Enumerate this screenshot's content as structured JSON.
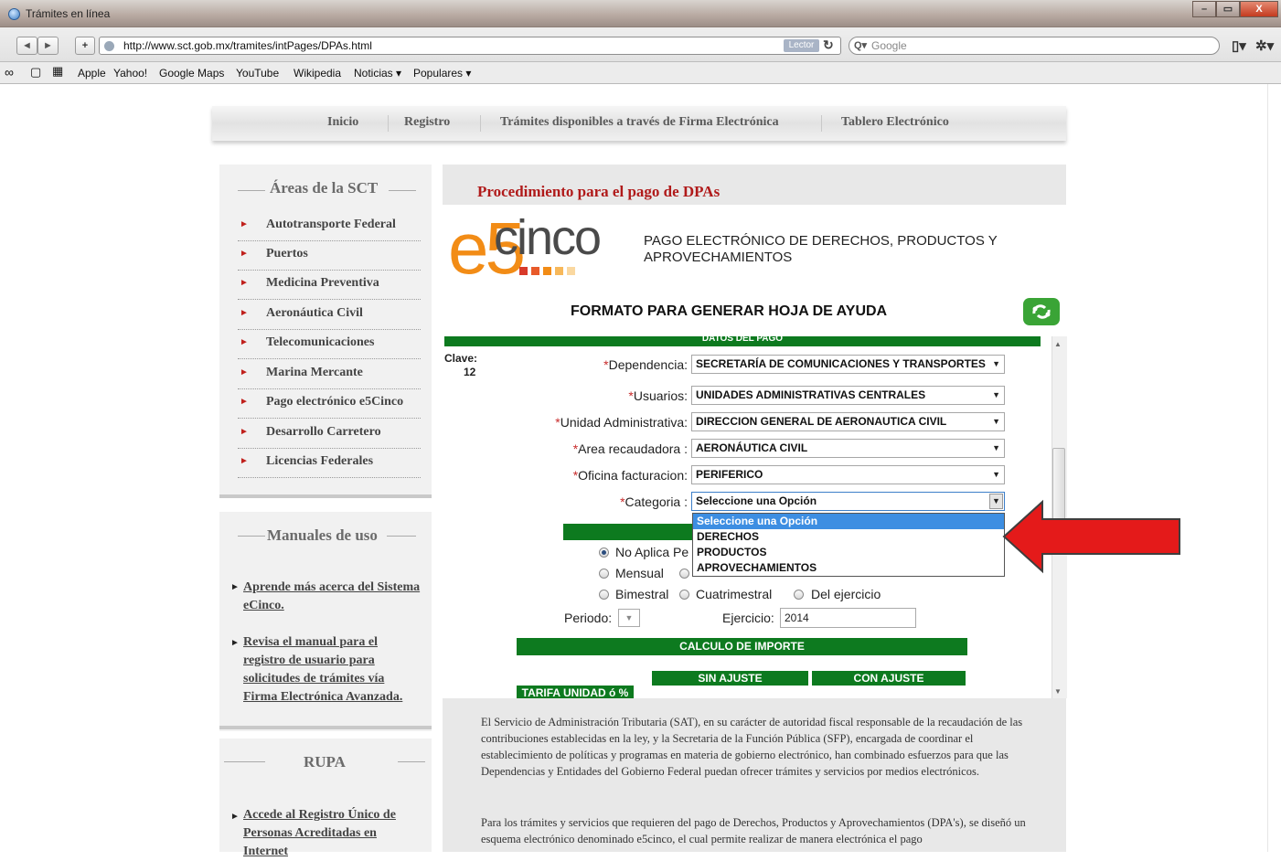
{
  "window": {
    "title": "Trámites en línea",
    "minimize": "–",
    "restore": "▭",
    "close": "X"
  },
  "toolbar": {
    "back": "◄",
    "forward": "►",
    "add": "+",
    "url": "http://www.sct.gob.mx/tramites/intPages/DPAs.html",
    "reader": "Lector",
    "reload": "↻",
    "search_placeholder": "Google",
    "search_glyph": "Q▾",
    "page_menu": "▯▾",
    "gear_menu": "✲▾"
  },
  "bookmarks": {
    "items": [
      "Apple",
      "Yahoo!",
      "Google Maps",
      "YouTube",
      "Wikipedia",
      "Noticias ▾",
      "Populares ▾"
    ]
  },
  "topnav": {
    "items": [
      "Inicio",
      "Registro",
      "Trámites disponibles a través de Firma Electrónica",
      "Tablero Electrónico"
    ]
  },
  "sidebar": {
    "areas_title": "Áreas de la SCT",
    "areas": [
      "Autotransporte Federal",
      "Puertos",
      "Medicina Preventiva",
      "Aeronáutica Civil",
      "Telecomunicaciones",
      "Marina Mercante",
      "Pago electrónico e5Cinco",
      "Desarrollo Carretero",
      "Licencias Federales"
    ],
    "manuales_title": "Manuales de uso",
    "manuales": [
      "Aprende más acerca del Sistema eCinco.",
      "Revisa el manual para el registro de usuario para solicitudes de trámites vía Firma Electrónica Avanzada."
    ],
    "rupa_title": "RUPA",
    "rupa": [
      "Accede al Registro Único de Personas Acreditadas en Internet"
    ]
  },
  "main": {
    "title": "Procedimiento para el pago  de DPAs",
    "logo_e": "e5",
    "logo_cinco": "cinco",
    "subtitle": "PAGO ELECTRÓNICO DE DERECHOS, PRODUCTOS Y APROVECHAMIENTOS",
    "formato": "FORMATO PARA GENERAR HOJA DE AYUDA",
    "datos_bar": "DATOS DEL PAGO",
    "clave_label": "Clave:",
    "clave_value": "12",
    "fields": [
      {
        "label": "Dependencia:",
        "value": "SECRETARÍA DE COMUNICACIONES Y TRANSPORTES"
      },
      {
        "label": "Usuarios:",
        "value": "UNIDADES ADMINISTRATIVAS CENTRALES"
      },
      {
        "label": "Unidad Administrativa:",
        "value": "DIRECCION GENERAL DE AERONAUTICA CIVIL"
      },
      {
        "label": "Area recaudadora :",
        "value": "AERONÁUTICA CIVIL"
      },
      {
        "label": "Oficina facturacion:",
        "value": "PERIFERICO"
      },
      {
        "label": "Categoria :",
        "value": "Seleccione una Opción"
      }
    ],
    "dropdown_options": [
      "Seleccione una Opción",
      "DERECHOS",
      "PRODUCTOS",
      "APROVECHAMIENTOS"
    ],
    "radios": {
      "no_aplica": "No Aplica Pe",
      "mensual": "Mensual",
      "bimestral": "Bimestral",
      "cuatrimestral": "Cuatrimestral",
      "del_ejercicio": "Del ejercicio",
      "selected": "no_aplica"
    },
    "periodo_label": "Periodo:",
    "ejercicio_label": "Ejercicio:",
    "ejercicio_value": "2014",
    "calculo_bar": "CALCULO DE IMPORTE",
    "sin_ajuste": "SIN AJUSTE",
    "con_ajuste": "CON AJUSTE",
    "tarifa": "TARIFA UNIDAD ó %",
    "paragraph1": "El Servicio de Administración Tributaria (SAT), en su carácter de autoridad fiscal responsable de la recaudación de las contribuciones establecidas en la ley, y la Secretaria de la Función Pública (SFP), encargada de coordinar el establecimiento de políticas y programas en materia de gobierno electrónico, han combinado esfuerzos para que las Dependencias y Entidades del Gobierno Federal puedan ofrecer trámites y servicios por medios electrónicos.",
    "paragraph2": "Para los trámites y servicios que requieren del pago de Derechos, Productos y Aprovechamientos (DPA's), se diseñó un esquema electrónico denominado e5cinco, el cual permite realizar de manera electrónica el pago"
  },
  "colors": {
    "accent_red": "#b01a1a",
    "green": "#0d7a1f",
    "arrow": "#e41a1a",
    "logo_orange": "#f28c16"
  }
}
